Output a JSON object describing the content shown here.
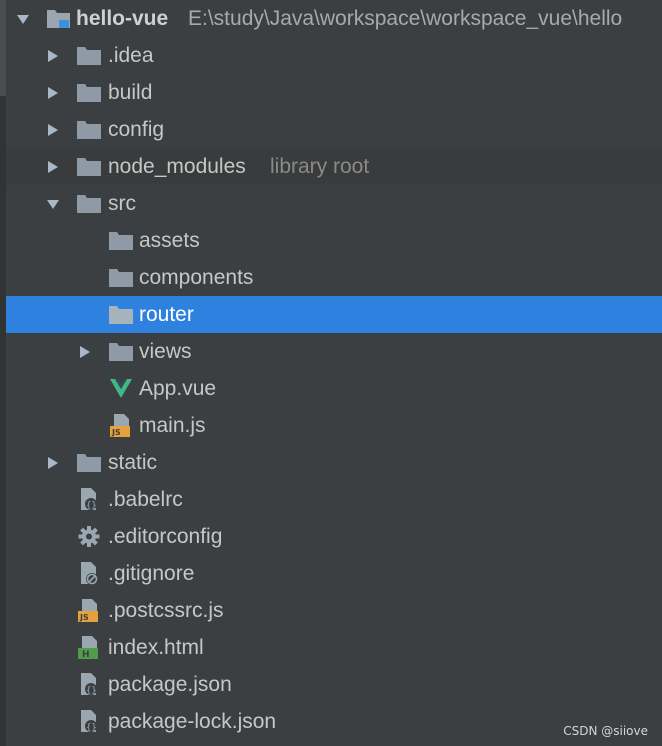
{
  "project": {
    "name": "hello-vue",
    "path": "E:\\study\\Java\\workspace\\workspace_vue\\hello"
  },
  "items": [
    {
      "label": ".idea"
    },
    {
      "label": "build"
    },
    {
      "label": "config"
    },
    {
      "label": "node_modules",
      "hint": "library root"
    },
    {
      "label": "src"
    },
    {
      "label": "assets"
    },
    {
      "label": "components"
    },
    {
      "label": "router"
    },
    {
      "label": "views"
    },
    {
      "label": "App.vue"
    },
    {
      "label": "main.js"
    },
    {
      "label": "static"
    },
    {
      "label": ".babelrc"
    },
    {
      "label": ".editorconfig"
    },
    {
      "label": ".gitignore"
    },
    {
      "label": ".postcssrc.js"
    },
    {
      "label": "index.html"
    },
    {
      "label": "package.json"
    },
    {
      "label": "package-lock.json"
    }
  ],
  "watermark": "CSDN @siiove",
  "colors": {
    "background": "#3c3f41",
    "selection": "#2f81e0",
    "vue_green": "#41b883",
    "js_badge": "#e6a03c",
    "html_badge": "#4f9d4a"
  }
}
